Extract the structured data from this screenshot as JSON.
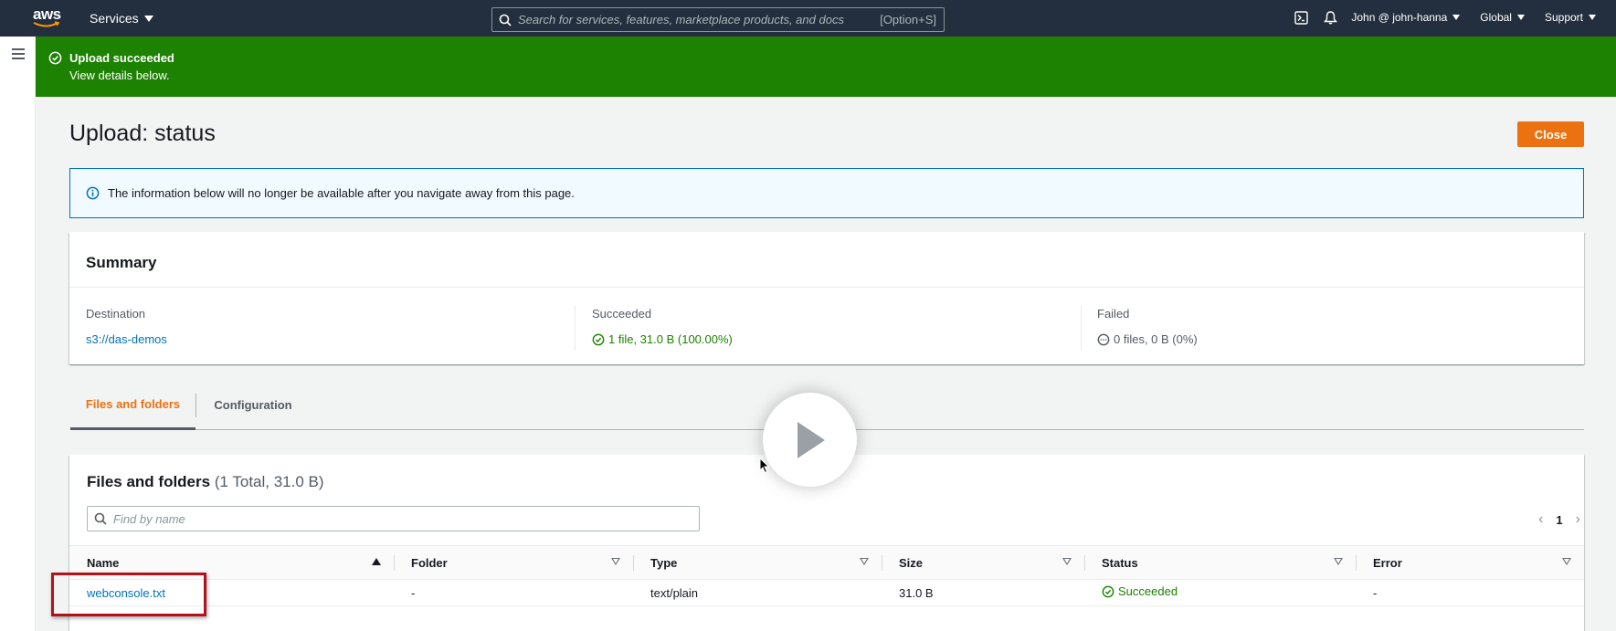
{
  "topnav": {
    "logo_text": "aws",
    "services_label": "Services",
    "search_placeholder": "Search for services, features, marketplace products, and docs",
    "search_shortcut": "[Option+S]",
    "user_label": "John @ john-hanna",
    "region_label": "Global",
    "support_label": "Support"
  },
  "flash": {
    "title": "Upload succeeded",
    "message": "View details below."
  },
  "page": {
    "title": "Upload: status",
    "close_label": "Close"
  },
  "info_alert": {
    "text": "The information below will no longer be available after you navigate away from this page."
  },
  "summary": {
    "heading": "Summary",
    "destination_label": "Destination",
    "destination_value": "s3://das-demos",
    "succeeded_label": "Succeeded",
    "succeeded_value": "1 file, 31.0 B (100.00%)",
    "failed_label": "Failed",
    "failed_value": "0 files, 0 B (0%)"
  },
  "tabs": [
    {
      "label": "Files and folders",
      "active": true
    },
    {
      "label": "Configuration",
      "active": false
    }
  ],
  "files": {
    "heading": "Files and folders",
    "count": "(1 Total, 31.0 B)",
    "find_placeholder": "Find by name",
    "page_number": "1",
    "columns": [
      "Name",
      "Folder",
      "Type",
      "Size",
      "Status",
      "Error"
    ],
    "rows": [
      {
        "name": "webconsole.txt",
        "folder": "-",
        "type": "text/plain",
        "size": "31.0 B",
        "status": "Succeeded",
        "error": "-"
      }
    ]
  },
  "colors": {
    "nav_bg": "#232f3e",
    "success_green": "#1d8102",
    "primary_orange": "#ec7211",
    "link_blue": "#0073bb",
    "highlight_red": "#b3121b"
  }
}
